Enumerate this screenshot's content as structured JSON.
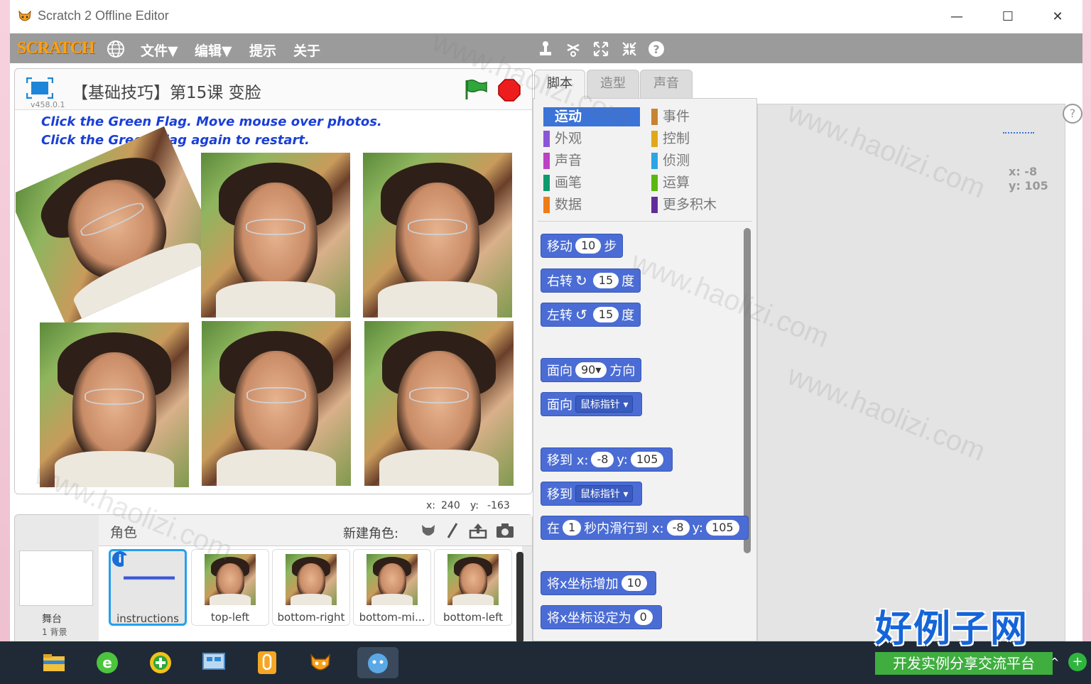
{
  "window": {
    "title": "Scratch 2 Offline Editor",
    "min_glyph": "—",
    "max_glyph": "☐",
    "close_glyph": "✕"
  },
  "menubar": {
    "logo": "SCRATCH",
    "items": [
      "文件▼",
      "编辑▼",
      "提示",
      "关于"
    ]
  },
  "stage": {
    "version": "v458.0.1",
    "project_title": "【基础技巧】第15课 变脸",
    "instruction_line1": "Click the Green Flag. Move mouse over photos.",
    "instruction_line2": "Click the Green Flag again to restart.",
    "mouse_x_label": "x:",
    "mouse_x": "240",
    "mouse_y_label": "y:",
    "mouse_y": "-163"
  },
  "sprites": {
    "label": "角色",
    "new_sprite_label": "新建角色:",
    "stage_name": "舞台",
    "backdrop_count": "1 背景",
    "items": [
      {
        "name": "instructions",
        "selected": true
      },
      {
        "name": "top-left",
        "selected": false
      },
      {
        "name": "bottom-right",
        "selected": false
      },
      {
        "name": "bottom-mi...",
        "selected": false
      },
      {
        "name": "bottom-left",
        "selected": false
      }
    ]
  },
  "tabs": [
    "脚本",
    "造型",
    "声音"
  ],
  "categories": [
    {
      "label": "运动",
      "color": "#4a6cd4",
      "active": true
    },
    {
      "label": "事件",
      "color": "#c88330"
    },
    {
      "label": "外观",
      "color": "#8a55d7"
    },
    {
      "label": "控制",
      "color": "#e1a91a"
    },
    {
      "label": "声音",
      "color": "#bb42c3"
    },
    {
      "label": "侦测",
      "color": "#2ca5e2"
    },
    {
      "label": "画笔",
      "color": "#0e9a6c"
    },
    {
      "label": "运算",
      "color": "#5cb712"
    },
    {
      "label": "数据",
      "color": "#ee7d16"
    },
    {
      "label": "更多积木",
      "color": "#632d99"
    }
  ],
  "blocks": {
    "move": {
      "pre": "移动",
      "val": "10",
      "post": "步"
    },
    "turn_right": {
      "pre": "右转",
      "icon": "↻",
      "val": "15",
      "post": "度"
    },
    "turn_left": {
      "pre": "左转",
      "icon": "↺",
      "val": "15",
      "post": "度"
    },
    "point_dir": {
      "pre": "面向",
      "val": "90▾",
      "post": "方向"
    },
    "point_towards": {
      "pre": "面向",
      "dd": "鼠标指针 ▾"
    },
    "goto_xy": {
      "pre": "移到 x:",
      "x": "-8",
      "ylabel": "y:",
      "y": "105"
    },
    "goto": {
      "pre": "移到",
      "dd": "鼠标指针 ▾"
    },
    "glide": {
      "pre": "在",
      "secs": "1",
      "mid": "秒内滑行到 x:",
      "x": "-8",
      "ylabel": "y:",
      "y": "105"
    },
    "change_x": {
      "pre": "将x坐标增加",
      "val": "10"
    },
    "set_x": {
      "pre": "将x坐标设定为",
      "val": "0"
    }
  },
  "script_area": {
    "x_label": "x:",
    "x": "-8",
    "y_label": "y:",
    "y": "105",
    "help": "?"
  },
  "watermark": {
    "big": "好例子网",
    "small": "开发实例分享交流平台",
    "diag": "www.haolizi.com"
  },
  "taskbar": {
    "chevron": "^",
    "tray": "+"
  }
}
